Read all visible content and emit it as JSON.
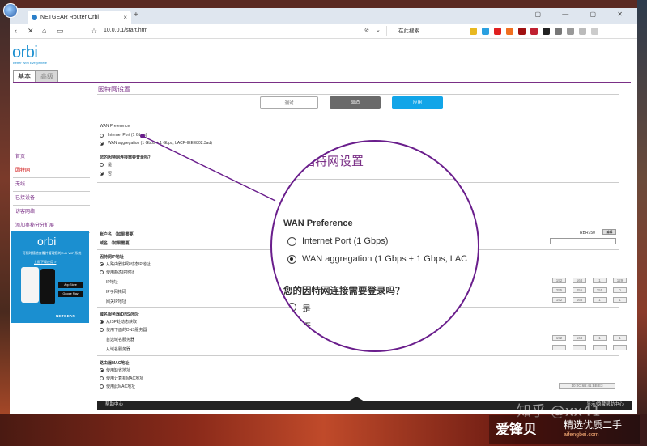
{
  "browser": {
    "tab_title": "NETGEAR Router Orbi",
    "new_tab": "+",
    "close_tab": "×",
    "url": "10.0.0.1/start.htm",
    "search_placeholder": "在此搜索",
    "window_controls": "▢ — ▢ ✕"
  },
  "router": {
    "logo": "orbi",
    "tagline": "Better WiFi Everywhere",
    "tabs": [
      {
        "label": "基本"
      },
      {
        "label": "高级"
      }
    ],
    "sidebar": [
      {
        "label": "首页"
      },
      {
        "label": "因特网"
      },
      {
        "label": "无线"
      },
      {
        "label": "已接设备"
      },
      {
        "label": "访客网络"
      },
      {
        "label": "添加奥秘分分扩展"
      }
    ],
    "ad": {
      "logo": "orbi",
      "text": "可随时随地查看并管理您的Orbi WiFi系统",
      "link": "立即下载应用 >",
      "store1": "App Store",
      "store2": "Google Play",
      "brand": "NETGEAR"
    },
    "main": {
      "title": "因特网设置",
      "buttons": {
        "test": "测试",
        "cancel": "取消",
        "apply": "应用"
      },
      "wan_preference": "WAN Preference",
      "wan_options": [
        "Internet Port (1 Gbps)",
        "WAN aggregation (1 Gbps + 1 Gbps, LACP-IEEE802.3ad)"
      ],
      "login_question": "您的因特网连接需要登录吗？",
      "login_options": [
        "是",
        "否"
      ],
      "account_name": "帐户名 （如果需要）",
      "account_value": "RBR750",
      "edit": "编辑",
      "domain_name": "域名 （如果需要）",
      "ip_section": "因特网IP地址",
      "ip_options": [
        "从路由器获取动态IP地址",
        "使用静态IP地址"
      ],
      "ip_rows": [
        {
          "label": "IP地址",
          "values": [
            "192",
            "168",
            "1",
            "129"
          ]
        },
        {
          "label": "IP子网掩码",
          "values": [
            "255",
            "255",
            "255",
            "0"
          ]
        },
        {
          "label": "网关IP地址",
          "values": [
            "192",
            "168",
            "1",
            "1"
          ]
        }
      ],
      "dns_section": "域名服务器(DNS)地址",
      "dns_options": [
        "从ISP处动态获取",
        "使用下面的DNS服务器"
      ],
      "dns_rows": [
        {
          "label": "首选域名服务器",
          "values": [
            "192",
            "168",
            "1",
            "1"
          ]
        },
        {
          "label": "从域名服务器",
          "values": [
            "",
            "",
            "",
            ""
          ]
        }
      ],
      "mac_section": "路由器MAC地址",
      "mac_options": [
        "使用缺省地址",
        "使用计算机MAC地址",
        "使用此MAC地址"
      ],
      "mac_value": "10:0C:6B:41:BB:E3",
      "help": "帮助中心",
      "help_right": "显示/隐藏帮助中心"
    }
  },
  "magnifier": {
    "title": "因特网设置",
    "wan_preference": "WAN Preference",
    "option1": "Internet Port (1 Gbps)",
    "option2": "WAN aggregation (1 Gbps + 1 Gbps, LAC",
    "question": "您的因特网连接需要登录吗？",
    "yes": "是",
    "no": "否"
  },
  "watermark": {
    "zhihu": "知乎 @xx41",
    "brand": "爱锋贝",
    "slogan": "精选优质二手",
    "url": "aifengbei.com"
  }
}
